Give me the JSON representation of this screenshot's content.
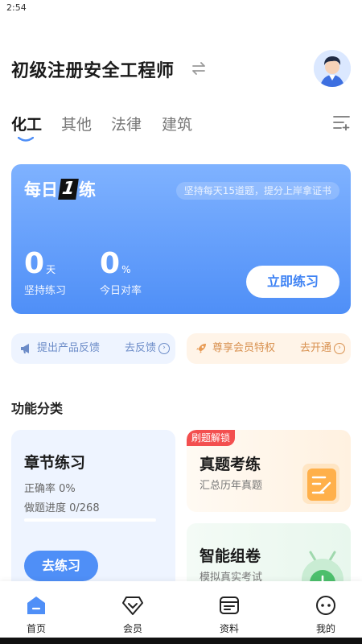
{
  "status_bar": {
    "time": "2:54"
  },
  "header": {
    "title": "初级注册安全工程师",
    "switch_icon": "switch-arrows-icon",
    "avatar_icon": "user-avatar"
  },
  "tabs": [
    {
      "label": "化工",
      "active": true
    },
    {
      "label": "其他",
      "active": false
    },
    {
      "label": "法律",
      "active": false
    },
    {
      "label": "建筑",
      "active": false
    }
  ],
  "tab_menu_icon": "list-add-icon",
  "daily_card": {
    "title_prefix": "每日",
    "title_number": "1",
    "title_suffix": "练",
    "tip": "坚持每天15道题，提分上岸拿证书",
    "stats": [
      {
        "value": "0",
        "unit": "天",
        "label": "坚持练习"
      },
      {
        "value": "0",
        "unit": "%",
        "label": "今日对率"
      }
    ],
    "button": "立即练习"
  },
  "pills": {
    "feedback": {
      "text": "提出产品反馈",
      "action": "去反馈",
      "icon": "megaphone-icon"
    },
    "vip": {
      "text": "尊享会员特权",
      "action": "去开通",
      "icon": "rocket-icon"
    }
  },
  "section_title": "功能分类",
  "chapter_card": {
    "title": "章节练习",
    "accuracy_label": "正确率 0%",
    "progress_label": "做题进度 0/268",
    "progress_done": 0,
    "progress_total": 268,
    "button": "去练习"
  },
  "exam_card": {
    "badge": "刷题解锁",
    "title": "真题考练",
    "subtitle": "汇总历年真题",
    "icon": "exam-paper-icon"
  },
  "smart_card": {
    "title": "智能组卷",
    "subtitle": "模拟真实考试",
    "icon": "robot-icon"
  },
  "bottom_nav": [
    {
      "label": "首页",
      "icon": "home-icon",
      "active": true
    },
    {
      "label": "会员",
      "icon": "vip-diamond-icon",
      "active": false
    },
    {
      "label": "资料",
      "icon": "document-icon",
      "active": false
    },
    {
      "label": "我的",
      "icon": "profile-icon",
      "active": false
    }
  ],
  "colors": {
    "primary": "#4f8ff7",
    "card_gradient_top": "#7fb2ff",
    "vip_orange": "#d89150",
    "badge_red": "#f34f4f"
  }
}
